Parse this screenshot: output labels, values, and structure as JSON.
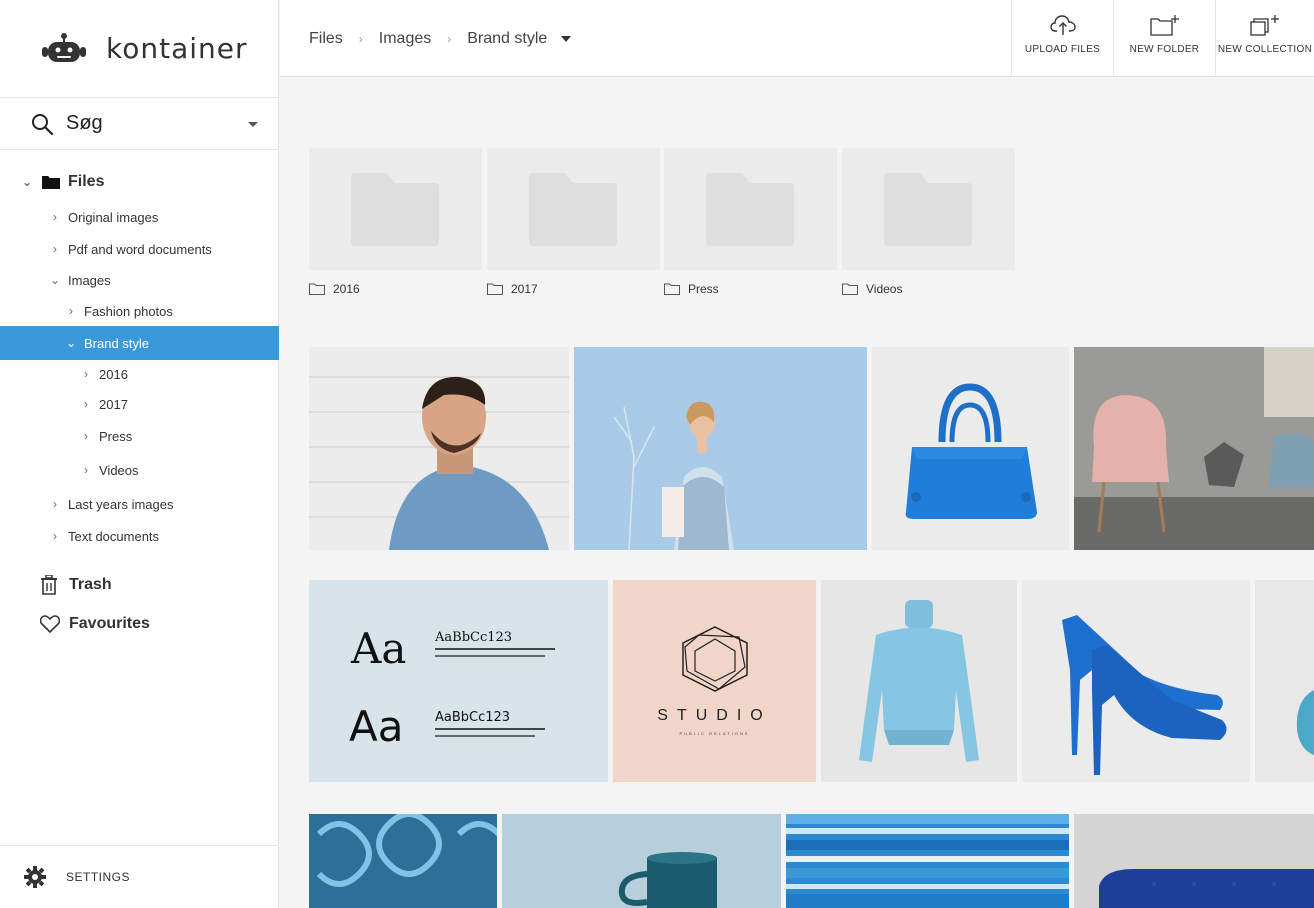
{
  "app": {
    "name": "kontainer"
  },
  "search": {
    "label": "Søg"
  },
  "tree": {
    "root": "Files",
    "items": [
      {
        "label": "Original images"
      },
      {
        "label": "Pdf and word documents"
      },
      {
        "label": "Images"
      },
      {
        "label": "Fashion photos"
      },
      {
        "label": "Brand style"
      },
      {
        "label": "2016"
      },
      {
        "label": "2017"
      },
      {
        "label": "Press"
      },
      {
        "label": "Videos"
      },
      {
        "label": "Last years images"
      },
      {
        "label": "Text documents"
      }
    ],
    "trash": "Trash",
    "favourites": "Favourites"
  },
  "settings": {
    "label": "SETTINGS"
  },
  "breadcrumb": {
    "items": [
      "Files",
      "Images",
      "Brand style"
    ]
  },
  "actions": {
    "upload": "UPLOAD FILES",
    "new_folder": "NEW FOLDER",
    "new_collection": "NEW COLLECTION"
  },
  "folders": [
    "2016",
    "2017",
    "Press",
    "Videos"
  ],
  "images": {
    "typography_sample": "AaBbCc123",
    "typography_big": "Aa",
    "studio_title": "STUDIO",
    "studio_sub": "PUBLIC RELATIONS"
  },
  "colors": {
    "accent": "#3a9ad9",
    "blue_product": "#1e7ed8"
  }
}
